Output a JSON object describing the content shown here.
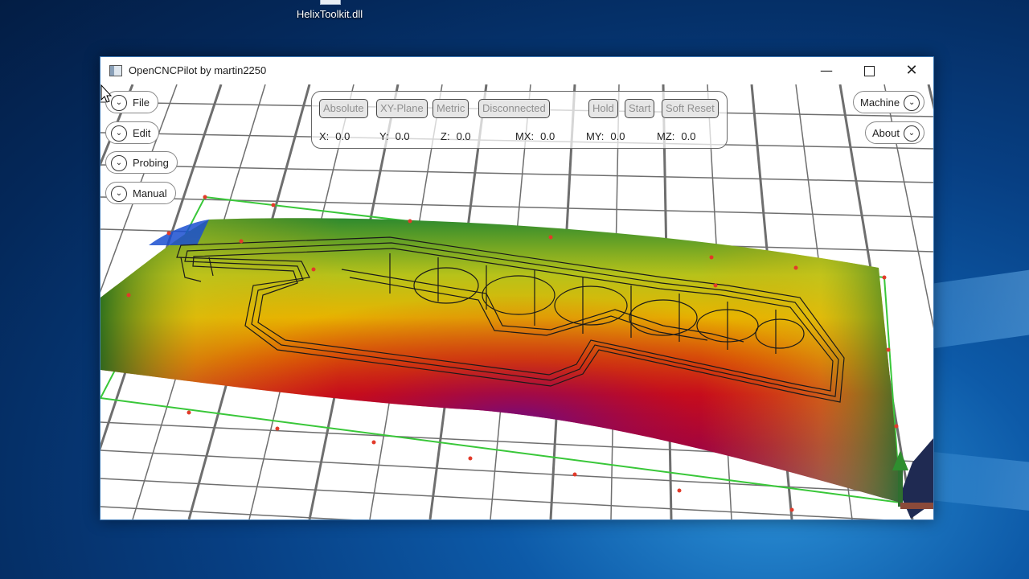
{
  "desktop": {
    "icon_label": "HelixToolkit.dll"
  },
  "window": {
    "title": "OpenCNCPilot by martin2250",
    "controls": {
      "minimize": "—",
      "maximize": "",
      "close": "✕"
    }
  },
  "left_menu": [
    {
      "label": "File",
      "icon": "chevron-down-icon"
    },
    {
      "label": "Edit",
      "icon": "chevron-down-icon"
    },
    {
      "label": "Probing",
      "icon": "chevron-down-icon"
    },
    {
      "label": "Manual",
      "icon": "chevron-down-icon"
    }
  ],
  "right_menu": [
    {
      "label": "Machine",
      "icon": "chevron-down-icon"
    },
    {
      "label": "About",
      "icon": "chevron-down-icon"
    }
  ],
  "status_panel": {
    "buttons": [
      "Absolute",
      "XY-Plane",
      "Metric",
      "Disconnected",
      "Hold",
      "Start",
      "Soft Reset"
    ],
    "coords": [
      {
        "label": "X:",
        "value": "0.0"
      },
      {
        "label": "Y:",
        "value": "0.0"
      },
      {
        "label": "Z:",
        "value": "0.0"
      },
      {
        "label": "MX:",
        "value": "0.0"
      },
      {
        "label": "MY:",
        "value": "0.0"
      },
      {
        "label": "MZ:",
        "value": "0.0"
      }
    ]
  },
  "colors": {
    "boundary": "#39c739",
    "probe_point": "#e23a2a",
    "grid": "#6e6e6e",
    "toolpath": "#1a1a1a"
  }
}
